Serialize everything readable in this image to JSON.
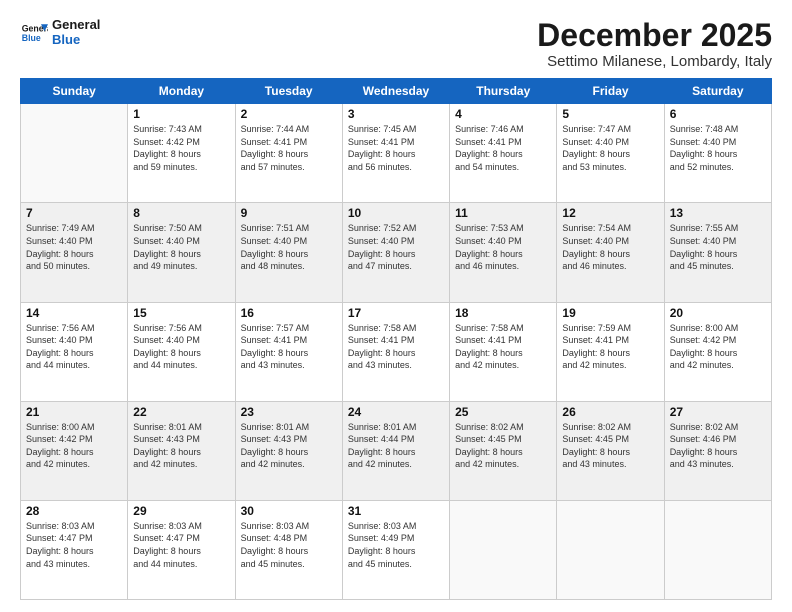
{
  "header": {
    "logo_line1": "General",
    "logo_line2": "Blue",
    "month": "December 2025",
    "location": "Settimo Milanese, Lombardy, Italy"
  },
  "weekdays": [
    "Sunday",
    "Monday",
    "Tuesday",
    "Wednesday",
    "Thursday",
    "Friday",
    "Saturday"
  ],
  "weeks": [
    [
      {
        "day": "",
        "empty": true
      },
      {
        "day": "1",
        "sunrise": "7:43 AM",
        "sunset": "4:42 PM",
        "daylight": "8 hours and 59 minutes."
      },
      {
        "day": "2",
        "sunrise": "7:44 AM",
        "sunset": "4:41 PM",
        "daylight": "8 hours and 57 minutes."
      },
      {
        "day": "3",
        "sunrise": "7:45 AM",
        "sunset": "4:41 PM",
        "daylight": "8 hours and 56 minutes."
      },
      {
        "day": "4",
        "sunrise": "7:46 AM",
        "sunset": "4:41 PM",
        "daylight": "8 hours and 54 minutes."
      },
      {
        "day": "5",
        "sunrise": "7:47 AM",
        "sunset": "4:40 PM",
        "daylight": "8 hours and 53 minutes."
      },
      {
        "day": "6",
        "sunrise": "7:48 AM",
        "sunset": "4:40 PM",
        "daylight": "8 hours and 52 minutes."
      }
    ],
    [
      {
        "day": "7",
        "sunrise": "7:49 AM",
        "sunset": "4:40 PM",
        "daylight": "8 hours and 50 minutes."
      },
      {
        "day": "8",
        "sunrise": "7:50 AM",
        "sunset": "4:40 PM",
        "daylight": "8 hours and 49 minutes."
      },
      {
        "day": "9",
        "sunrise": "7:51 AM",
        "sunset": "4:40 PM",
        "daylight": "8 hours and 48 minutes."
      },
      {
        "day": "10",
        "sunrise": "7:52 AM",
        "sunset": "4:40 PM",
        "daylight": "8 hours and 47 minutes."
      },
      {
        "day": "11",
        "sunrise": "7:53 AM",
        "sunset": "4:40 PM",
        "daylight": "8 hours and 46 minutes."
      },
      {
        "day": "12",
        "sunrise": "7:54 AM",
        "sunset": "4:40 PM",
        "daylight": "8 hours and 46 minutes."
      },
      {
        "day": "13",
        "sunrise": "7:55 AM",
        "sunset": "4:40 PM",
        "daylight": "8 hours and 45 minutes."
      }
    ],
    [
      {
        "day": "14",
        "sunrise": "7:56 AM",
        "sunset": "4:40 PM",
        "daylight": "8 hours and 44 minutes."
      },
      {
        "day": "15",
        "sunrise": "7:56 AM",
        "sunset": "4:40 PM",
        "daylight": "8 hours and 44 minutes."
      },
      {
        "day": "16",
        "sunrise": "7:57 AM",
        "sunset": "4:41 PM",
        "daylight": "8 hours and 43 minutes."
      },
      {
        "day": "17",
        "sunrise": "7:58 AM",
        "sunset": "4:41 PM",
        "daylight": "8 hours and 43 minutes."
      },
      {
        "day": "18",
        "sunrise": "7:58 AM",
        "sunset": "4:41 PM",
        "daylight": "8 hours and 42 minutes."
      },
      {
        "day": "19",
        "sunrise": "7:59 AM",
        "sunset": "4:41 PM",
        "daylight": "8 hours and 42 minutes."
      },
      {
        "day": "20",
        "sunrise": "8:00 AM",
        "sunset": "4:42 PM",
        "daylight": "8 hours and 42 minutes."
      }
    ],
    [
      {
        "day": "21",
        "sunrise": "8:00 AM",
        "sunset": "4:42 PM",
        "daylight": "8 hours and 42 minutes."
      },
      {
        "day": "22",
        "sunrise": "8:01 AM",
        "sunset": "4:43 PM",
        "daylight": "8 hours and 42 minutes."
      },
      {
        "day": "23",
        "sunrise": "8:01 AM",
        "sunset": "4:43 PM",
        "daylight": "8 hours and 42 minutes."
      },
      {
        "day": "24",
        "sunrise": "8:01 AM",
        "sunset": "4:44 PM",
        "daylight": "8 hours and 42 minutes."
      },
      {
        "day": "25",
        "sunrise": "8:02 AM",
        "sunset": "4:45 PM",
        "daylight": "8 hours and 42 minutes."
      },
      {
        "day": "26",
        "sunrise": "8:02 AM",
        "sunset": "4:45 PM",
        "daylight": "8 hours and 43 minutes."
      },
      {
        "day": "27",
        "sunrise": "8:02 AM",
        "sunset": "4:46 PM",
        "daylight": "8 hours and 43 minutes."
      }
    ],
    [
      {
        "day": "28",
        "sunrise": "8:03 AM",
        "sunset": "4:47 PM",
        "daylight": "8 hours and 43 minutes."
      },
      {
        "day": "29",
        "sunrise": "8:03 AM",
        "sunset": "4:47 PM",
        "daylight": "8 hours and 44 minutes."
      },
      {
        "day": "30",
        "sunrise": "8:03 AM",
        "sunset": "4:48 PM",
        "daylight": "8 hours and 45 minutes."
      },
      {
        "day": "31",
        "sunrise": "8:03 AM",
        "sunset": "4:49 PM",
        "daylight": "8 hours and 45 minutes."
      },
      {
        "day": "",
        "empty": true
      },
      {
        "day": "",
        "empty": true
      },
      {
        "day": "",
        "empty": true
      }
    ]
  ]
}
